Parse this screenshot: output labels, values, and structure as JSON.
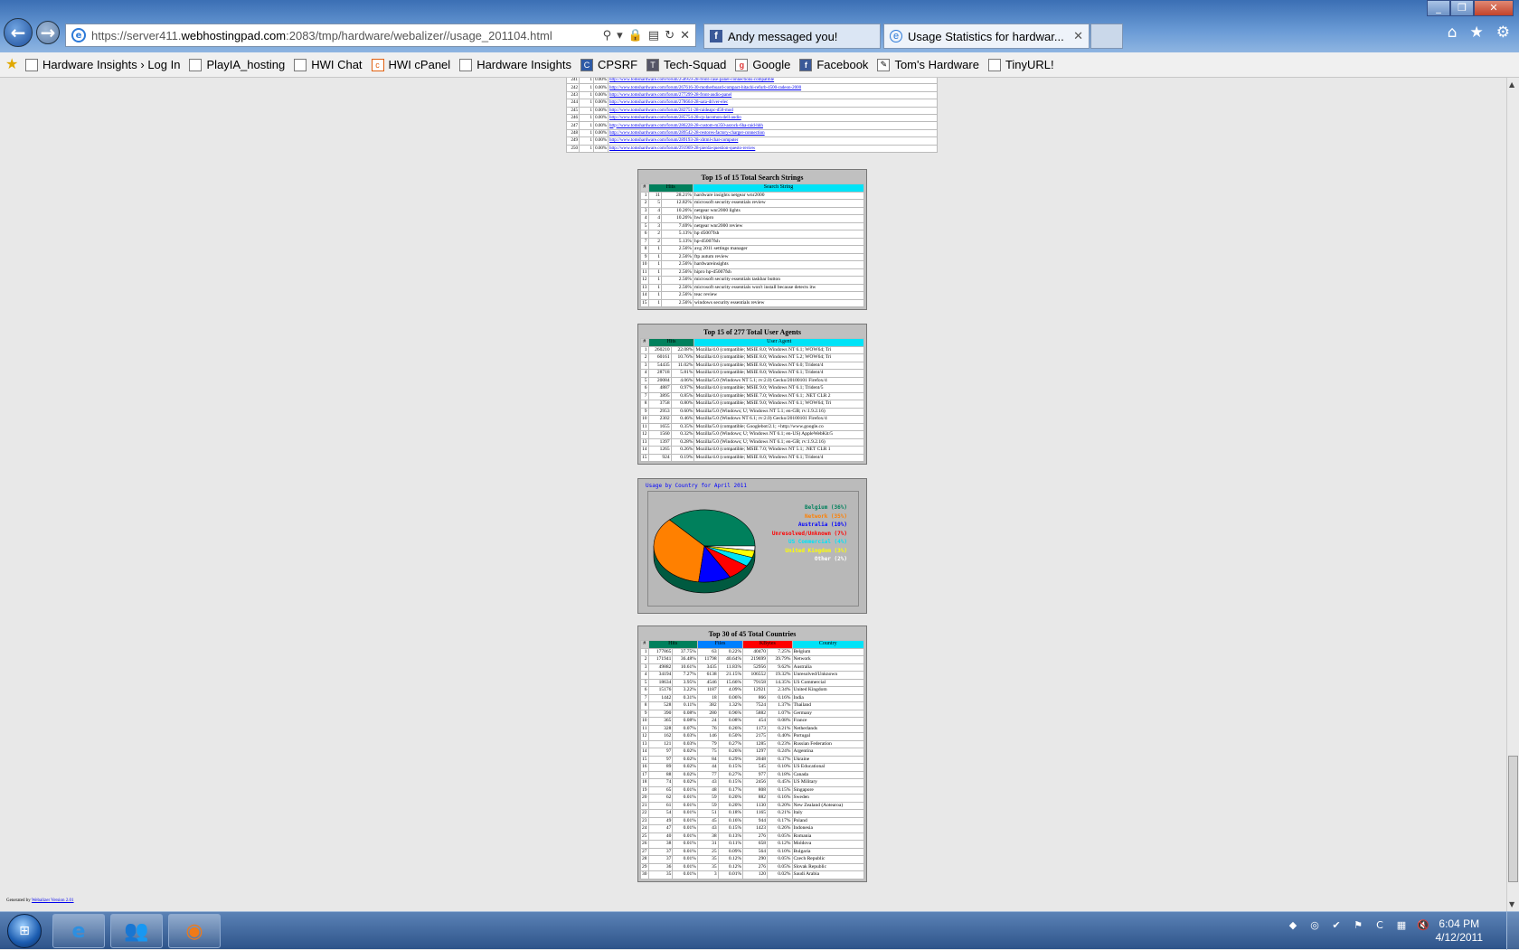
{
  "browser": {
    "url_prefix": "https://server411.",
    "url_host": "webhostingpad.com",
    "url_rest": ":2083/tmp/hardware/webalizer//usage_201104.html",
    "tabs": [
      {
        "label": "Andy messaged you!"
      },
      {
        "label": "Usage Statistics for hardwar..."
      }
    ],
    "window_buttons": [
      "_",
      "❐",
      "✕"
    ]
  },
  "favorites": [
    "Hardware Insights › Log In",
    "PlayIA_hosting",
    "HWI Chat",
    "HWI cPanel",
    "Hardware Insights",
    "CPSRF",
    "Tech-Squad",
    "Google",
    "Facebook",
    "Tom's Hardware",
    "TinyURL!"
  ],
  "referrers": {
    "rows": [
      [
        "241",
        "1",
        "0.00%",
        "http://www.tomshardware.com/forum/258959-28-front-case-panel-connections-compatible"
      ],
      [
        "242",
        "1",
        "0.00%",
        "http://www.tomshardware.com/forum/267616-30-motherboard-compact-hitachi-refurb-4500-radeon-2000"
      ],
      [
        "243",
        "1",
        "0.00%",
        "http://www.tomshardware.com/forum/277299-28-front-audio-panel"
      ],
      [
        "244",
        "1",
        "0.00%",
        "http://www.tomshardware.com/forum/278664-28-sata-driver-elec"
      ],
      [
        "245",
        "1",
        "0.00%",
        "http://www.tomshardware.com/forum/282751-28-raideapc-d50-mod"
      ],
      [
        "246",
        "1",
        "0.00%",
        "http://www.tomshardware.com/forum/285754-28-cp-lacomon-dell-audio"
      ],
      [
        "247",
        "1",
        "0.00%",
        "http://www.tomshardware.com/forum/286228-28-custom-m350-asrock-6ha-raid-hhh"
      ],
      [
        "248",
        "1",
        "0.00%",
        "http://www.tomshardware.com/forum/289542-28-restores-factory-charger-connection"
      ],
      [
        "249",
        "1",
        "0.00%",
        "http://www.tomshardware.com/forum/289193-28-xhtml-chat-computer"
      ],
      [
        "250",
        "1",
        "0.00%",
        "http://www.tomshardware.com/forum/291969-28-pierda-question-questo-review"
      ]
    ]
  },
  "search": {
    "title": "Top 15 of 15 Total Search Strings",
    "headers": [
      "#",
      "Hits",
      "Search String"
    ],
    "rows": [
      [
        "1",
        "11",
        "28.21%",
        "hardware insights netgear wnr2000"
      ],
      [
        "2",
        "5",
        "12.82%",
        "microsoft security essentials review"
      ],
      [
        "3",
        "4",
        "10.26%",
        "netgear wnr2000 lights"
      ],
      [
        "4",
        "4",
        "10.26%",
        "hwi hipro"
      ],
      [
        "5",
        "3",
        "7.69%",
        "netgear wnr2000 review"
      ],
      [
        "6",
        "2",
        "5.13%",
        "hp d5007fsh"
      ],
      [
        "7",
        "2",
        "5.13%",
        "hp-d5007fsh"
      ],
      [
        "8",
        "1",
        "2.56%",
        "avg 2011 settings manager"
      ],
      [
        "9",
        "1",
        "2.56%",
        "ftp autum review"
      ],
      [
        "10",
        "1",
        "2.56%",
        "hardwareinsights"
      ],
      [
        "11",
        "1",
        "2.56%",
        "hipro hp-d5007fsh"
      ],
      [
        "12",
        "1",
        "2.56%",
        "microsoft security essentials taskbar button"
      ],
      [
        "13",
        "1",
        "2.56%",
        "microsoft security essentials won't install because detects itw"
      ],
      [
        "14",
        "1",
        "2.56%",
        "teac review"
      ],
      [
        "15",
        "1",
        "2.56%",
        "windows security essentials review"
      ]
    ]
  },
  "agents": {
    "title": "Top 15 of 277 Total User Agents",
    "headers": [
      "#",
      "Hits",
      "User Agent"
    ],
    "rows": [
      [
        "1",
        "260210",
        "22.08%",
        "Mozilla/4.0 (compatible; MSIE 8.0; Windows NT 6.1; WOW64; Tri"
      ],
      [
        "2",
        "60161",
        "10.76%",
        "Mozilla/4.0 (compatible; MSIE 8.0; Windows NT 5.2; WOW64; Tri"
      ],
      [
        "3",
        "54435",
        "11.02%",
        "Mozilla/4.0 (compatible; MSIE 8.0; Windows NT 6.0; Trident/4"
      ],
      [
        "4",
        "28718",
        "5.81%",
        "Mozilla/4.0 (compatible; MSIE 8.0; Windows NT 6.1; Trident/4"
      ],
      [
        "5",
        "20084",
        "4.06%",
        "Mozilla/5.0 (Windows NT 5.1; rv:2.0) Gecko/20100101 Firefox/4"
      ],
      [
        "6",
        "4887",
        "0.97%",
        "Mozilla/4.0 (compatible; MSIE 9.0; Windows NT 6.1; Trident/5"
      ],
      [
        "7",
        "3895",
        "0.85%",
        "Mozilla/4.0 (compatible; MSIE 7.0; Windows NT 6.1; .NET CLR 2"
      ],
      [
        "8",
        "3758",
        "0.80%",
        "Mozilla/5.0 (compatible; MSIE 9.0; Windows NT 6.1; WOW64; Tri"
      ],
      [
        "9",
        "2953",
        "0.60%",
        "Mozilla/5.0 (Windows; U; Windows NT 5.1; en-GB; rv:1.9.2.16)"
      ],
      [
        "10",
        "2302",
        "0.46%",
        "Mozilla/5.0 (Windows NT 6.1; rv:2.0) Gecko/20100101 Firefox/4"
      ],
      [
        "11",
        "1655",
        "0.35%",
        "Mozilla/5.0 (compatible; Googlebot/2.1; +http://www.google.co"
      ],
      [
        "12",
        "1560",
        "0.32%",
        "Mozilla/5.0 (Windows; U; Windows NT 6.1; en-US) AppleWebKit/5"
      ],
      [
        "13",
        "1397",
        "0.28%",
        "Mozilla/5.0 (Windows; U; Windows NT 6.1; en-GB; rv:1.9.2.16)"
      ],
      [
        "14",
        "1265",
        "0.26%",
        "Mozilla/4.0 (compatible; MSIE 7.0; Windows NT 5.1; .NET CLR 1"
      ],
      [
        "15",
        "924",
        "0.19%",
        "Mozilla/4.0 (compatible; MSIE 8.0; Windows NT 6.1; Trident/4"
      ]
    ]
  },
  "chart_data": {
    "type": "pie",
    "title": "Usage by Country for April 2011",
    "slices": [
      {
        "label": "Belgium (36%)",
        "value": 36,
        "color": "#00805c"
      },
      {
        "label": "Network (35%)",
        "value": 35,
        "color": "#ff8000"
      },
      {
        "label": "Australia (10%)",
        "value": 10,
        "color": "#0000ff"
      },
      {
        "label": "Unresolved/Unknown (7%)",
        "value": 7,
        "color": "#ff0000"
      },
      {
        "label": "US Commercial (4%)",
        "value": 4,
        "color": "#00e3f7"
      },
      {
        "label": "United Kingdom (3%)",
        "value": 3,
        "color": "#ffff00"
      },
      {
        "label": "Other (2%)",
        "value": 2,
        "color": "#ffffff"
      }
    ],
    "legend": "right"
  },
  "countries": {
    "title": "Top 30 of 45 Total Countries",
    "headers": [
      "#",
      "Hits",
      "Files",
      "KBytes",
      "Country"
    ],
    "rows": [
      [
        "1",
        "177865",
        "37.75%",
        "63",
        "0.22%",
        "40470",
        "7.25%",
        "Belgium"
      ],
      [
        "2",
        "171941",
        "36.48%",
        "11798",
        "40.64%",
        "219699",
        "39.79%",
        "Network"
      ],
      [
        "3",
        "49882",
        "10.61%",
        "3435",
        "11.83%",
        "52956",
        "9.62%",
        "Australia"
      ],
      [
        "4",
        "34194",
        "7.27%",
        "6138",
        "21.15%",
        "106552",
        "19.32%",
        "Unresolved/Unknown"
      ],
      [
        "5",
        "18634",
        "3.95%",
        "4546",
        "15.66%",
        "79158",
        "14.35%",
        "US Commercial"
      ],
      [
        "6",
        "15176",
        "3.22%",
        "1187",
        "4.09%",
        "12921",
        "2.34%",
        "United Kingdom"
      ],
      [
        "7",
        "1442",
        "0.31%",
        "18",
        "0.06%",
        "866",
        "0.16%",
        "India"
      ],
      [
        "8",
        "528",
        "0.11%",
        "382",
        "1.32%",
        "7524",
        "1.37%",
        "Thailand"
      ],
      [
        "9",
        "390",
        "0.08%",
        "280",
        "0.96%",
        "5882",
        "1.07%",
        "Germany"
      ],
      [
        "10",
        "365",
        "0.08%",
        "24",
        "0.08%",
        "454",
        "0.08%",
        "France"
      ],
      [
        "11",
        "328",
        "0.07%",
        "76",
        "0.26%",
        "1173",
        "0.21%",
        "Netherlands"
      ],
      [
        "12",
        "162",
        "0.03%",
        "146",
        "0.50%",
        "2175",
        "0.40%",
        "Portugal"
      ],
      [
        "13",
        "121",
        "0.03%",
        "79",
        "0.27%",
        "1285",
        "0.23%",
        "Russian Federation"
      ],
      [
        "14",
        "97",
        "0.02%",
        "75",
        "0.26%",
        "1297",
        "0.24%",
        "Argentina"
      ],
      [
        "15",
        "97",
        "0.02%",
        "84",
        "0.29%",
        "2048",
        "0.37%",
        "Ukraine"
      ],
      [
        "16",
        "89",
        "0.02%",
        "44",
        "0.15%",
        "545",
        "0.10%",
        "US Educational"
      ],
      [
        "17",
        "88",
        "0.02%",
        "77",
        "0.27%",
        "977",
        "0.18%",
        "Canada"
      ],
      [
        "18",
        "74",
        "0.02%",
        "43",
        "0.15%",
        "2456",
        "0.45%",
        "US Military"
      ],
      [
        "19",
        "65",
        "0.01%",
        "48",
        "0.17%",
        "808",
        "0.15%",
        "Singapore"
      ],
      [
        "20",
        "62",
        "0.01%",
        "59",
        "0.20%",
        "882",
        "0.16%",
        "Sweden"
      ],
      [
        "21",
        "61",
        "0.01%",
        "59",
        "0.20%",
        "1130",
        "0.20%",
        "New Zealand (Aotearoa)"
      ],
      [
        "22",
        "54",
        "0.01%",
        "51",
        "0.18%",
        "1165",
        "0.21%",
        "Italy"
      ],
      [
        "23",
        "49",
        "0.01%",
        "45",
        "0.16%",
        "944",
        "0.17%",
        "Poland"
      ],
      [
        "24",
        "47",
        "0.01%",
        "43",
        "0.15%",
        "1423",
        "0.26%",
        "Indonesia"
      ],
      [
        "25",
        "40",
        "0.01%",
        "38",
        "0.13%",
        "276",
        "0.05%",
        "Romania"
      ],
      [
        "26",
        "38",
        "0.01%",
        "31",
        "0.11%",
        "658",
        "0.12%",
        "Moldova"
      ],
      [
        "27",
        "37",
        "0.01%",
        "25",
        "0.09%",
        "564",
        "0.10%",
        "Bulgaria"
      ],
      [
        "28",
        "37",
        "0.01%",
        "35",
        "0.12%",
        "290",
        "0.05%",
        "Czech Republic"
      ],
      [
        "29",
        "36",
        "0.01%",
        "35",
        "0.12%",
        "276",
        "0.05%",
        "Slovak Republic"
      ],
      [
        "30",
        "35",
        "0.01%",
        "3",
        "0.01%",
        "120",
        "0.02%",
        "Saudi Arabia"
      ]
    ]
  },
  "footer": {
    "prefix": "Generated by",
    "link": "Webalizer Version 2.01"
  },
  "taskbar": {
    "time": "6:04 PM",
    "date": "4/12/2011"
  }
}
